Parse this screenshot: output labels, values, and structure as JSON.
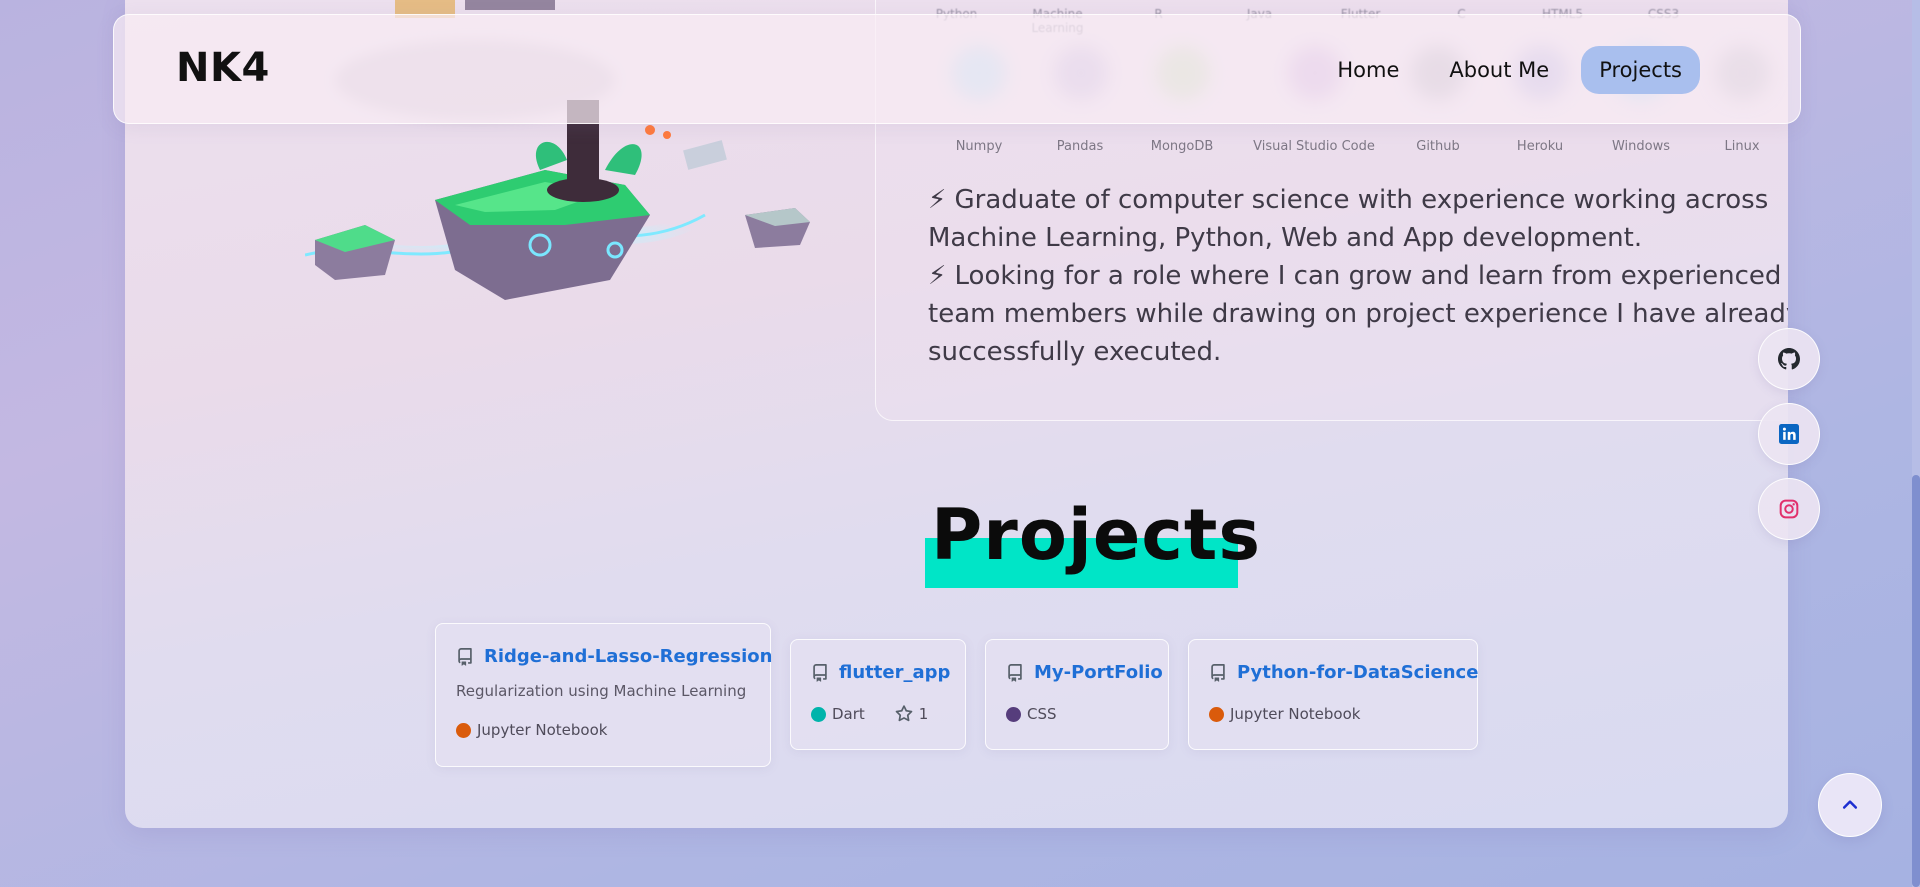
{
  "header": {
    "logo": "NK4",
    "nav": [
      {
        "label": "Home"
      },
      {
        "label": "About Me"
      },
      {
        "label": "Projects",
        "active": true
      }
    ]
  },
  "skills": {
    "top_row": [
      "Python",
      "Machine Learning",
      "R",
      "Java",
      "Flutter",
      "C",
      "HTML5",
      "CSS3"
    ],
    "names": [
      "Numpy",
      "Pandas",
      "MongoDB",
      "Visual Studio Code",
      "Github",
      "Heroku",
      "Windows",
      "Linux"
    ]
  },
  "about": {
    "lines": [
      "⚡ Graduate of computer science with experience working across",
      "Machine Learning, Python, Web and App development.",
      "⚡ Looking for a role where I can grow and learn from experienced",
      "team members while drawing on project experience I have already",
      "successfully executed."
    ]
  },
  "projects": {
    "title": "Projects",
    "repos": [
      {
        "name": "Ridge-and-Lasso-Regression",
        "description": "Regularization using Machine Learning",
        "language": "Jupyter Notebook",
        "lang_color": "#DA5B0B"
      },
      {
        "name": "flutter_app",
        "language": "Dart",
        "lang_color": "#00B4AB",
        "stars": "1"
      },
      {
        "name": "My-PortFolio",
        "language": "CSS",
        "lang_color": "#563D7C"
      },
      {
        "name": "Python-for-DataScience",
        "language": "Jupyter Notebook",
        "lang_color": "#DA5B0B"
      }
    ]
  },
  "social": [
    "github-icon",
    "linkedin-icon",
    "instagram-icon"
  ],
  "colors": {
    "accent_highlight": "#00e5c7",
    "nav_active": "#a9bfee",
    "repo_link": "#1f6fd6",
    "linkedin": "#0a66c2",
    "instagram": "#e1306c"
  }
}
